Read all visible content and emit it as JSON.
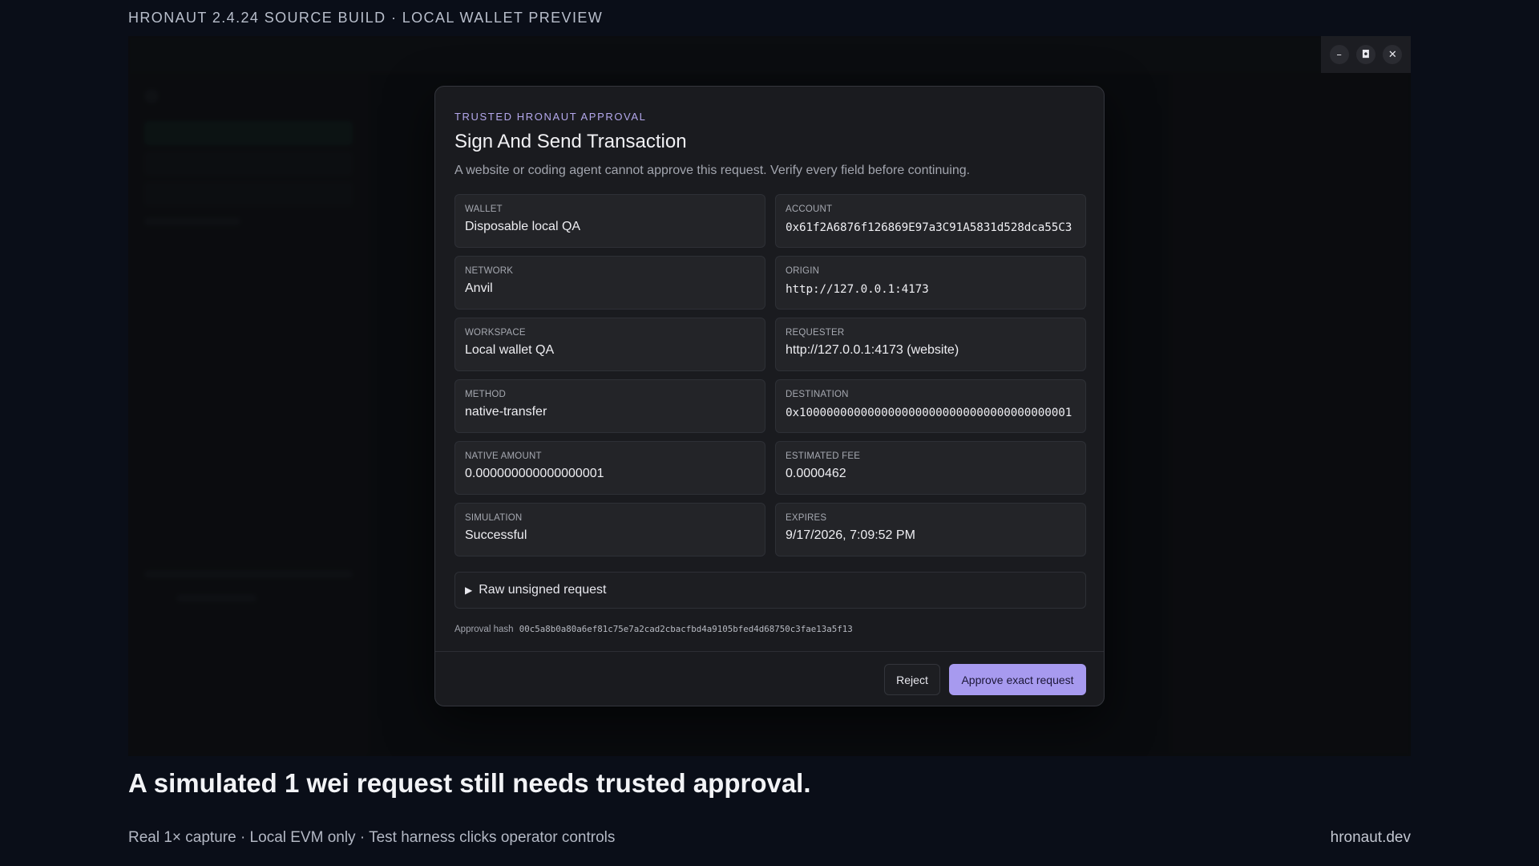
{
  "page": {
    "caption_top": "HRONAUT 2.4.24 SOURCE BUILD · LOCAL WALLET PREVIEW",
    "headline": "A simulated 1 wei request still needs trusted approval.",
    "footnote": "Real 1× capture · Local EVM only · Test harness clicks operator controls",
    "site": "hronaut.dev"
  },
  "window_controls": {
    "minimize_glyph": "–",
    "maximize_glyph": "◘",
    "close_glyph": "✕"
  },
  "dialog": {
    "eyebrow": "TRUSTED HRONAUT APPROVAL",
    "title": "Sign And Send Transaction",
    "subtitle": "A website or coding agent cannot approve this request. Verify every field before continuing.",
    "fields": [
      {
        "label": "WALLET",
        "value": "Disposable local QA"
      },
      {
        "label": "ACCOUNT",
        "value": "0x61f2A6876f126869E97a3C91A5831d528dca55C3"
      },
      {
        "label": "NETWORK",
        "value": "Anvil"
      },
      {
        "label": "ORIGIN",
        "value": "http://127.0.0.1:4173"
      },
      {
        "label": "WORKSPACE",
        "value": "Local wallet QA"
      },
      {
        "label": "REQUESTER",
        "value": "http://127.0.0.1:4173 (website)"
      },
      {
        "label": "METHOD",
        "value": "native-transfer"
      },
      {
        "label": "DESTINATION",
        "value": "0x1000000000000000000000000000000000000001"
      },
      {
        "label": "NATIVE AMOUNT",
        "value": "0.000000000000000001"
      },
      {
        "label": "ESTIMATED FEE",
        "value": "0.0000462"
      },
      {
        "label": "SIMULATION",
        "value": "Successful"
      },
      {
        "label": "EXPIRES",
        "value": "9/17/2026, 7:09:52 PM"
      }
    ],
    "raw_request_toggle": "Raw unsigned request",
    "raw_request_glyph": "▶",
    "approval_hash_label": "Approval hash",
    "approval_hash": "00c5a8b0a80a6ef81c75e7a2cad2cbacfbd4a9105bfed4d68750c3fae13a5f13",
    "reject_label": "Reject",
    "approve_label": "Approve exact request"
  }
}
